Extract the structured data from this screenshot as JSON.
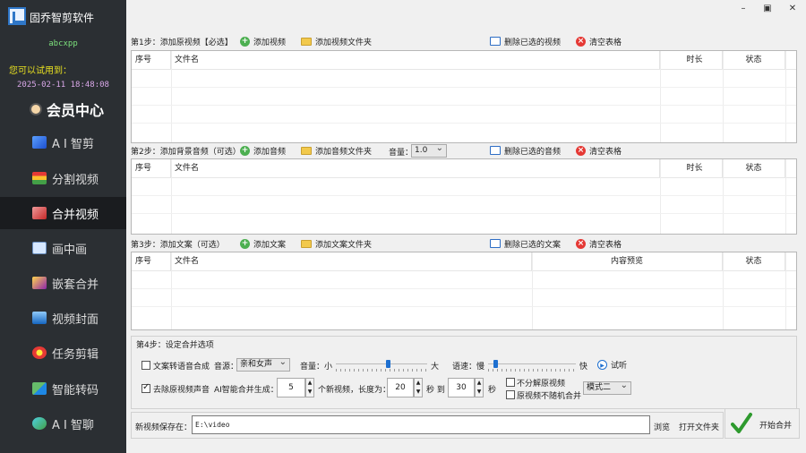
{
  "app": {
    "title": "固乔智剪软件",
    "username": "abcxpp",
    "trial_label": "您可以试用到：",
    "trial_date": "2025-02-11 18:48:08",
    "vip_label": "会员中心"
  },
  "nav": [
    {
      "label": "A I 智剪",
      "icon": "ai-clip-icon"
    },
    {
      "label": "分割视频",
      "icon": "split-video-icon"
    },
    {
      "label": "合并视频",
      "icon": "merge-video-icon",
      "active": true
    },
    {
      "label": "画中画",
      "icon": "picture-in-picture-icon"
    },
    {
      "label": "嵌套合并",
      "icon": "nested-merge-icon"
    },
    {
      "label": "视频封面",
      "icon": "video-cover-icon"
    },
    {
      "label": "任务剪辑",
      "icon": "task-edit-icon"
    },
    {
      "label": "智能转码",
      "icon": "transcode-icon"
    },
    {
      "label": "A I 智聊",
      "icon": "ai-chat-icon"
    }
  ],
  "window": {
    "minimize": "–",
    "maximize": "▣",
    "close": "✕"
  },
  "step1": {
    "label": "第1步：添加原视频【必选】",
    "add": "添加视频",
    "add_folder": "添加视频文件夹",
    "delete_selected": "删除已选的视频",
    "clear": "清空表格",
    "columns": [
      "序号",
      "文件名",
      "时长",
      "状态"
    ]
  },
  "step2": {
    "label": "第2步：添加背景音频（可选）",
    "add": "添加音频",
    "add_folder": "添加音频文件夹",
    "volume_label": "音量：",
    "volume_value": "1.0",
    "delete_selected": "删除已选的音频",
    "clear": "清空表格",
    "columns": [
      "序号",
      "文件名",
      "时长",
      "状态"
    ]
  },
  "step3": {
    "label": "第3步：添加文案（可选）",
    "add": "添加文案",
    "add_folder": "添加文案文件夹",
    "delete_selected": "删除已选的文案",
    "clear": "清空表格",
    "columns": [
      "序号",
      "文件名",
      "内容预览",
      "状态"
    ]
  },
  "step4": {
    "label": "第4步：设定合并选项",
    "tts_checkbox": "文案转语音合成",
    "tts_checked": false,
    "voice_label": "音源：",
    "voice_value": "亲和女声",
    "vol_label": "音量：小",
    "vol_big": "大",
    "vol_level": 0.58,
    "speed_label": "语速：慢",
    "speed_fast": "快",
    "speed_level": 0.06,
    "preview": "试听",
    "mute_checkbox": "去除原视频声音",
    "mute_checked": true,
    "ai_label": "AI智能合并生成：",
    "count_value": "5",
    "count_unit": "个新视频，长度为：",
    "len_from": "20",
    "sec_to": "秒 到",
    "len_to": "30",
    "sec": "秒",
    "no_split": "不分解原视频",
    "no_split_checked": false,
    "no_random": "原视频不随机合并",
    "no_random_checked": false,
    "mode_value": "模式二"
  },
  "save": {
    "label": "新视频保存在：",
    "path": "E:\\video",
    "browse": "浏览",
    "open_folder": "打开文件夹"
  },
  "start": {
    "label": "开始合并"
  }
}
